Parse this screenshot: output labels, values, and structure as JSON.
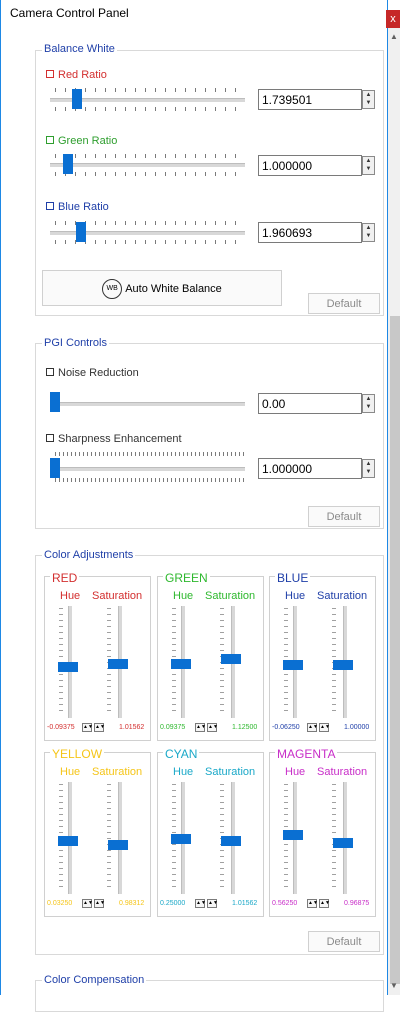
{
  "window": {
    "title": "Camera Control Panel",
    "close_label": "x"
  },
  "scrollbar": {
    "up_arrow": "▲",
    "down_arrow": "▼"
  },
  "balance_white": {
    "label": "Balance White",
    "red": {
      "label": "Red Ratio",
      "value": "1.739501",
      "level": 0.12,
      "color": "#d32f2f"
    },
    "green": {
      "label": "Green Ratio",
      "value": "1.000000",
      "level": 0.07,
      "color": "#2e9e2e"
    },
    "blue": {
      "label": "Blue Ratio",
      "value": "1.960693",
      "level": 0.14,
      "color": "#1f3fa8"
    },
    "auto_label": "Auto White Balance",
    "auto_icon_text": "WB",
    "default_label": "Default"
  },
  "pgi": {
    "label": "PGI Controls",
    "noise": {
      "label": "Noise Reduction",
      "value": "0.00",
      "level": 0.0
    },
    "sharpness": {
      "label": "Sharpness Enhancement",
      "value": "1.000000",
      "level": 0.0
    },
    "default_label": "Default"
  },
  "color_adjustments": {
    "label": "Color Adjustments",
    "hue_label": "Hue",
    "saturation_label": "Saturation",
    "groups": [
      {
        "name": "RED",
        "color": "#d32f2f",
        "hue": "-0.09375",
        "saturation": "1.01562"
      },
      {
        "name": "GREEN",
        "color": "#2eb82e",
        "hue": "0.09375",
        "saturation": "1.12500"
      },
      {
        "name": "BLUE",
        "color": "#1f3fa8",
        "hue": "-0.06250",
        "saturation": "1.00000"
      },
      {
        "name": "YELLOW",
        "color": "#f5c518",
        "hue": "0.03250",
        "saturation": "0.98312"
      },
      {
        "name": "CYAN",
        "color": "#1aa8c8",
        "hue": "0.25000",
        "saturation": "1.01562"
      },
      {
        "name": "MAGENTA",
        "color": "#c82ec8",
        "hue": "0.56250",
        "saturation": "0.96875"
      }
    ],
    "default_label": "Default"
  },
  "color_compensation": {
    "label": "Color Compensation"
  }
}
